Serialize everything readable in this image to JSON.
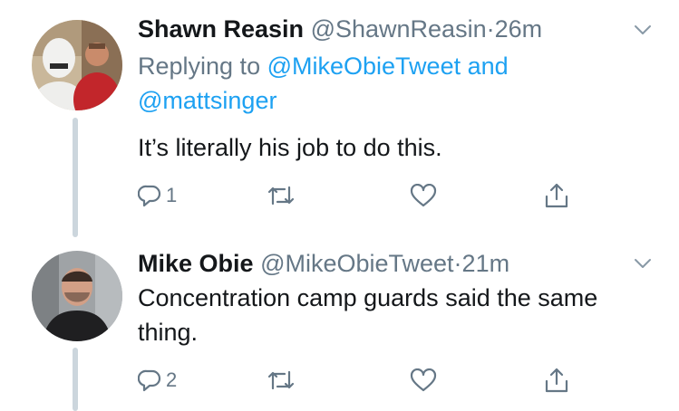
{
  "tweets": [
    {
      "name": "Shawn Reasin",
      "handle": "@ShawnReasin",
      "separator": "·",
      "time": "26m",
      "replying_prefix": "Replying to",
      "replying_to_1": "@MikeObieTweet",
      "replying_and": "and",
      "replying_to_2": "@mattsinger",
      "text": "It’s literally his job to do this.",
      "reply_count": "1",
      "avatar": "avatar-stormtrooper-photo"
    },
    {
      "name": "Mike Obie",
      "handle": "@MikeObieTweet",
      "separator": "·",
      "time": "21m",
      "text": "Concentration camp guards said the same thing.",
      "reply_count": "2",
      "avatar": "avatar-man-photo"
    }
  ],
  "icons": {
    "reply": "reply-icon",
    "retweet": "retweet-icon",
    "like": "heart-icon",
    "share": "share-icon",
    "more": "chevron-down-icon"
  },
  "colors": {
    "text": "#14171a",
    "secondary": "#657786",
    "link": "#1da1f2",
    "thread_line": "#ccd6dd"
  }
}
